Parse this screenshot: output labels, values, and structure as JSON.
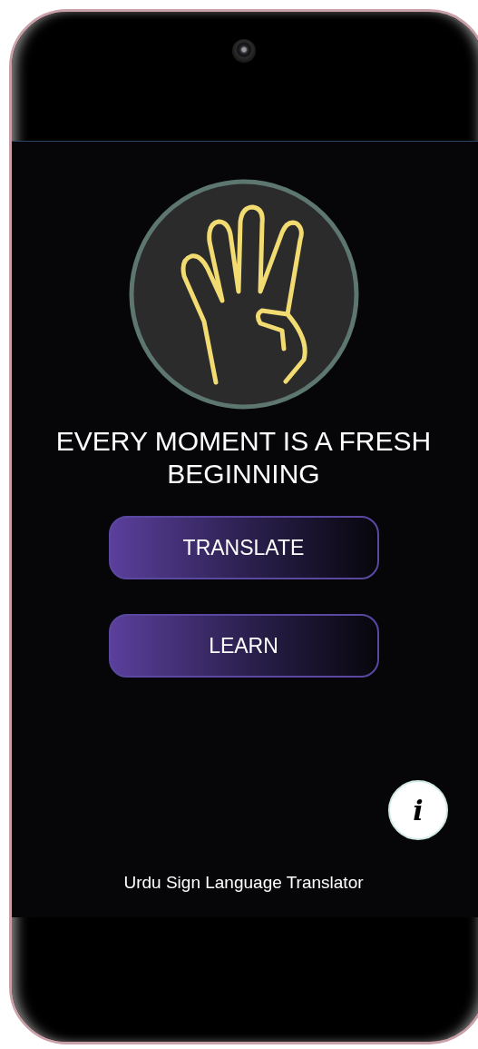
{
  "app": {
    "tagline": "EVERY MOMENT IS A FRESH BEGINNING",
    "buttons": [
      {
        "label": "TRANSLATE"
      },
      {
        "label": "LEARN"
      }
    ],
    "info_button": {
      "label": "i"
    },
    "footer": "Urdu Sign Language Translator"
  }
}
